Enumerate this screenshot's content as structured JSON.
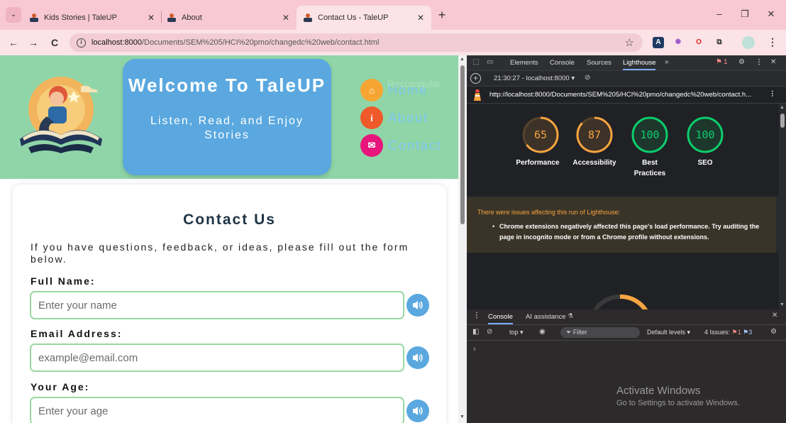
{
  "browser": {
    "tabs": [
      {
        "title": "Kids Stories | TaleUP",
        "close": "✕"
      },
      {
        "title": "About",
        "close": "✕"
      },
      {
        "title": "Contact Us - TaleUP",
        "close": "✕"
      }
    ],
    "new_tab": "+",
    "window_controls": {
      "minimize": "–",
      "restore": "❐",
      "close": "✕"
    },
    "nav": {
      "back": "←",
      "forward": "→",
      "reload": "C"
    },
    "url": {
      "host": "localhost:8000",
      "path": "/Documents/SEM%205/HCI%20pmo/changedc%20web/contact.html"
    },
    "extensions": [
      {
        "icon": "translate-extension-icon",
        "glyph": "A",
        "bg": "#1f3b63",
        "fg": "#ffffff"
      },
      {
        "icon": "ai-extension-icon",
        "glyph": "✺",
        "bg": "#fbe3e8",
        "fg": "#a05ac8"
      },
      {
        "icon": "opera-extension-icon",
        "glyph": "O",
        "bg": "#fbe3e8",
        "fg": "#e1251b"
      },
      {
        "icon": "puzzle-extension-icon",
        "glyph": "⧉",
        "bg": "#fbe3e8",
        "fg": "#333333"
      }
    ]
  },
  "site": {
    "welcome_title": "Welcome To TaleUP",
    "tagline": "Listen, Read, and Enjoy Stories",
    "nav_ghost": "Rectangular",
    "nav": [
      {
        "label": "Home",
        "icon": "home-icon",
        "glyph": "⌂",
        "color": "#f7a532"
      },
      {
        "label": "About",
        "icon": "info-icon",
        "glyph": "i",
        "color": "#ef5a2a"
      },
      {
        "label": "Contact",
        "icon": "mail-icon",
        "glyph": "✉",
        "color": "#e8157d"
      }
    ],
    "colors": {
      "header": "#8fd5a8",
      "welcome_box": "#5aa8df",
      "nav_text": "#7ec7f0",
      "input_border": "#9ad8a3"
    }
  },
  "contact": {
    "heading": "Contact Us",
    "intro": "If you have questions, feedback, or ideas, please fill out the form below.",
    "fields": [
      {
        "label": "Full Name:",
        "placeholder": "Enter your name"
      },
      {
        "label": "Email Address:",
        "placeholder": "example@email.com"
      },
      {
        "label": "Your Age:",
        "placeholder": "Enter your age"
      }
    ]
  },
  "devtools": {
    "tabs": [
      "Elements",
      "Console",
      "Sources",
      "Lighthouse"
    ],
    "active_tab": "Lighthouse",
    "issues_badge": "1",
    "lighthouse": {
      "run_label": "21:30:27 - localhost:8000",
      "url": "http://localhost:8000/Documents/SEM%205/HCI%20pmo/changedc%20web/contact.h...",
      "scores": [
        {
          "value": 65,
          "label": "Performance",
          "color": "#f7a440"
        },
        {
          "value": 87,
          "label": "Accessibility",
          "color": "#f7a440"
        },
        {
          "value": 100,
          "label": "Best Practices",
          "color": "#0cce6b"
        },
        {
          "value": 100,
          "label": "SEO",
          "color": "#0cce6b"
        }
      ],
      "warning_title": "There were issues affecting this run of Lighthouse:",
      "warning_body": "Chrome extensions negatively affected this page's load performance. Try auditing the page in incognito mode or from a Chrome profile without extensions."
    },
    "drawer": {
      "tabs": [
        "Console",
        "AI assistance"
      ],
      "context": "top ▾",
      "filter_placeholder": "Filter",
      "levels": "Default levels ▾",
      "issues_label": "4 Issues:",
      "issues_red": "1",
      "issues_blue": "3",
      "prompt": "›"
    }
  },
  "watermark": {
    "title": "Activate Windows",
    "subtitle": "Go to Settings to activate Windows."
  }
}
